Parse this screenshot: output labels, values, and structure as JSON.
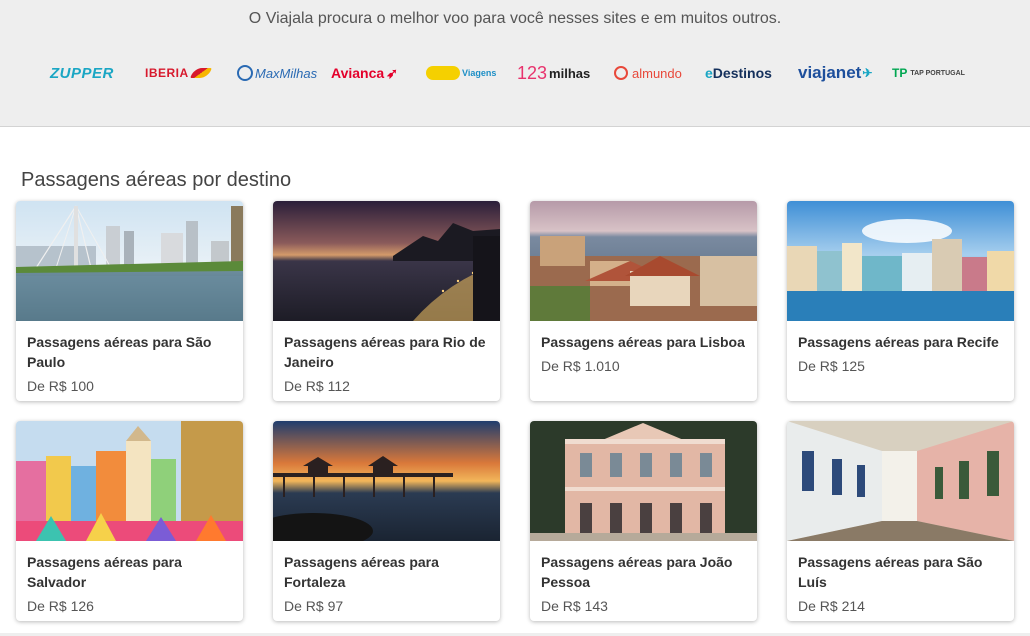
{
  "partners": {
    "caption": "O Viajala procura o melhor voo para você nesses sites e em muitos outros.",
    "logos": {
      "zupper": "ZUPPER",
      "iberia": "IBERIA",
      "maxmilhas": "MaxMilhas",
      "avianca": "Avianca",
      "viagens": "Viagens",
      "milhas_num": "123",
      "milhas_text": "milhas",
      "almundo": "almundo",
      "edestinos_e": "e",
      "edestinos_rest": "Destinos",
      "viajanet": "viajanet",
      "tap_logo": "TP",
      "tap_text": "TAP PORTUGAL"
    }
  },
  "section": {
    "title": "Passagens aéreas por destino"
  },
  "cards": [
    {
      "title": "Passagens aéreas para São Paulo",
      "price": "De R$ 100"
    },
    {
      "title": "Passagens aéreas para Rio de Janeiro",
      "price": "De R$ 112"
    },
    {
      "title": "Passagens aéreas para Lisboa",
      "price": "De R$ 1.010"
    },
    {
      "title": "Passagens aéreas para Recife",
      "price": "De R$ 125"
    },
    {
      "title": "Passagens aéreas para Salvador",
      "price": "De R$ 126"
    },
    {
      "title": "Passagens aéreas para Fortaleza",
      "price": "De R$ 97"
    },
    {
      "title": "Passagens aéreas para João Pessoa",
      "price": "De R$ 143"
    },
    {
      "title": "Passagens aéreas para São Luís",
      "price": "De R$ 214"
    }
  ],
  "colors": {
    "partners_bg": "#eeeeee",
    "zupper": "#1aa6c4",
    "iberia": "#d7192d",
    "avianca": "#e4002b",
    "viajanet": "#1d4f9c"
  }
}
